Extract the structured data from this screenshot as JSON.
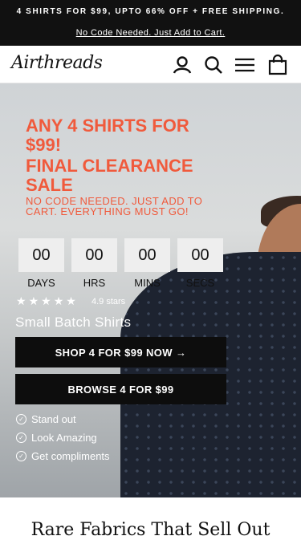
{
  "announcement": {
    "headline": "4 SHIRTS FOR $99, UPTO 66% OFF + FREE SHIPPING.",
    "link": "No Code Needed. Just Add to Cart."
  },
  "header": {
    "logo": "Airthreads",
    "icons": [
      "account-icon",
      "search-icon",
      "menu-icon",
      "cart-icon"
    ]
  },
  "hero": {
    "headline_1": "ANY 4 SHIRTS FOR $99!",
    "headline_2": "FINAL CLEARANCE SALE",
    "subtext": "NO CODE NEEDED. JUST ADD TO CART. EVERYTHING MUST GO!",
    "countdown": [
      {
        "value": "00",
        "label": "DAYS"
      },
      {
        "value": "00",
        "label": "HRS"
      },
      {
        "value": "00",
        "label": "MINS"
      },
      {
        "value": "00",
        "label": "SECS"
      }
    ],
    "rating": 5,
    "rating_text": "4.9 stars",
    "tagline": "Small Batch Shirts",
    "cta_primary": "SHOP 4 FOR $99 NOW →",
    "cta_secondary": "BROWSE 4 FOR $99",
    "benefits": [
      "Stand out",
      "Look Amazing",
      "Get compliments"
    ]
  },
  "section": {
    "title": "Rare Fabrics That Sell Out"
  },
  "colors": {
    "accent": "#f05a3c",
    "announcement_bg": "#111111",
    "button_bg": "#0d0d0d"
  }
}
